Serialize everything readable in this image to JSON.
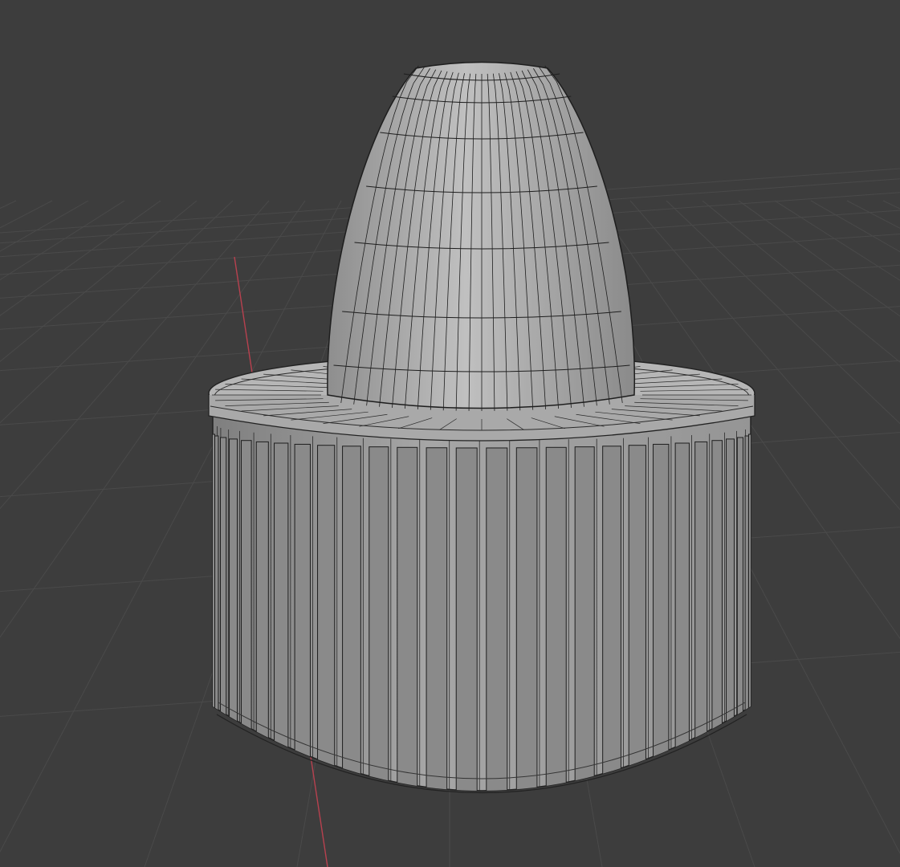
{
  "viewport": {
    "mode": "3d-viewport-wireframe-overlay",
    "background_color": "#3d3d3d",
    "grid_color": "#4a4a4a",
    "x_axis_color": "#b8414f",
    "mesh_color": "#9a9a9a",
    "wire_color": "#1e1e1e"
  },
  "objects": [
    {
      "name": "nose-cone",
      "shape": "paraboloid"
    },
    {
      "name": "slotted-cylinder-base",
      "shape": "cylinder",
      "slot_count": 28
    }
  ]
}
